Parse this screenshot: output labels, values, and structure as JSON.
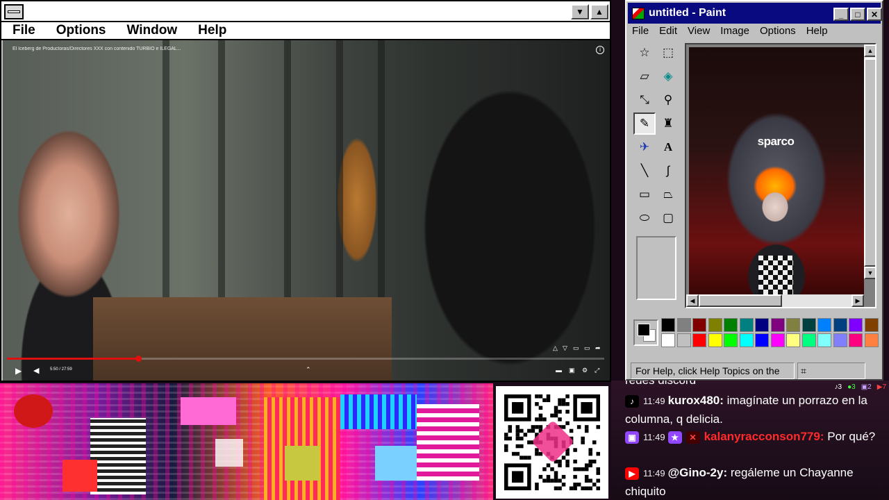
{
  "player": {
    "menu": [
      "File",
      "Options",
      "Window",
      "Help"
    ],
    "minimize_glyph": "▼",
    "maximize_glyph": "▲",
    "video_title": "El Iceberg de Productoras/Directores XXX con contenido TURBIO e ILEGAL...",
    "time_label": "5:50 / 27:59",
    "progress": 0.22
  },
  "paint": {
    "title": "untitled - Paint",
    "menu": [
      "File",
      "Edit",
      "View",
      "Image",
      "Options",
      "Help"
    ],
    "status_text": "For Help, click Help Topics on the",
    "canvas_brand": "sparco",
    "palette_top": [
      "#000000",
      "#808080",
      "#800000",
      "#808000",
      "#008000",
      "#008080",
      "#000080",
      "#800080",
      "#808040",
      "#004040",
      "#0080ff",
      "#004080",
      "#8000ff",
      "#804000"
    ],
    "palette_bottom": [
      "#ffffff",
      "#c0c0c0",
      "#ff0000",
      "#ffff00",
      "#00ff00",
      "#00ffff",
      "#0000ff",
      "#ff00ff",
      "#ffff80",
      "#00ff80",
      "#80ffff",
      "#8080ff",
      "#ff0080",
      "#ff8040"
    ],
    "foreground": "#000000",
    "background": "#ffffff"
  },
  "chat": {
    "partial_line": "redes discord",
    "counts": [
      "3",
      "3",
      "2",
      "7"
    ],
    "messages": [
      {
        "platform": "tiktok",
        "time": "11:49",
        "user": "kurox480:",
        "text": "imagínate un porrazo en la columna, q delicia.",
        "user_color": "#ffffff"
      },
      {
        "platform": "twitch",
        "time": "11:49",
        "user": "kalanyracconson779:",
        "text": "Por qué?",
        "user_color": "#ff2a2a"
      },
      {
        "platform": "youtube",
        "time": "11:49",
        "user": "@Gino-2y:",
        "text": "regáleme un Chayanne chiquito",
        "user_color": "#ffffff"
      }
    ]
  }
}
